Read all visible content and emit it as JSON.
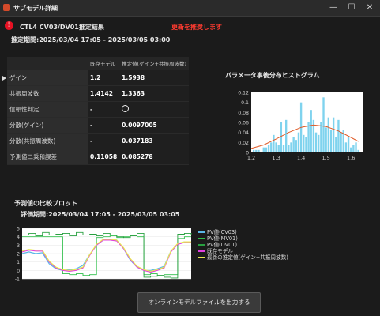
{
  "window": {
    "title": "サブモデル詳細",
    "minimize_glyph": "—",
    "maximize_glyph": "☐",
    "close_glyph": "✕"
  },
  "header": {
    "alert_glyph": "!",
    "title": "CTL4  CV03/DV01推定結果",
    "recommend": "更新を推奨します",
    "period": "推定期間:2025/03/04 17:05 - 2025/03/05 03:00"
  },
  "table": {
    "col_current": "既存モデル",
    "col_estimate": "推定値(ゲイン+共振周波数)",
    "rows": [
      {
        "label": "ゲイン",
        "current": "1.2",
        "estimate": "1.5938"
      },
      {
        "label": "共振周波数",
        "current": "1.4142",
        "estimate": "1.3363"
      },
      {
        "label": "信頼性判定",
        "current": "-",
        "estimate": ""
      },
      {
        "label": "分散(ゲイン)",
        "current": "-",
        "estimate": "0.0097005"
      },
      {
        "label": "分散(共振周波数)",
        "current": "-",
        "estimate": "0.037183"
      },
      {
        "label": "予測値二乗和誤差",
        "current": "0.11058",
        "estimate": "0.085278"
      }
    ]
  },
  "histogram": {
    "title": "パラメータ事後分布ヒストグラム",
    "bar_color": "#7fd3ee",
    "curve_color": "#e05a26"
  },
  "comparison": {
    "title": "予測値の比較プロット",
    "period": "評価期間:2025/03/04 17:05 - 2025/03/05 03:05"
  },
  "legend": [
    {
      "label": "PV値(CV03)",
      "color": "#5bb8e8"
    },
    {
      "label": "PV値(MV01)",
      "color": "#2fbf4a"
    },
    {
      "label": "PV値(DV01)",
      "color": "#28a040"
    },
    {
      "label": "既存モデル",
      "color": "#e040e0"
    },
    {
      "label": "最新の推定値(ゲイン+共振周波数)",
      "color": "#e8e850"
    }
  ],
  "export_button": "オンラインモデルファイルを出力する",
  "chart_data": [
    {
      "type": "bar",
      "title": "パラメータ事後分布ヒストグラム",
      "xlim": [
        1.2,
        1.65
      ],
      "ylim": [
        0,
        0.12
      ],
      "x_ticks": [
        "1.2",
        "1.3",
        "1.4",
        "1.5",
        "1.6"
      ],
      "y_ticks": [
        "0",
        "0.02",
        "0.04",
        "0.06",
        "0.08",
        "0.1",
        "0.12"
      ],
      "x": [
        1.21,
        1.22,
        1.23,
        1.25,
        1.26,
        1.27,
        1.28,
        1.29,
        1.3,
        1.31,
        1.32,
        1.33,
        1.34,
        1.35,
        1.36,
        1.37,
        1.38,
        1.39,
        1.4,
        1.41,
        1.42,
        1.43,
        1.44,
        1.45,
        1.46,
        1.47,
        1.48,
        1.49,
        1.5,
        1.51,
        1.52,
        1.53,
        1.54,
        1.55,
        1.56,
        1.57,
        1.58,
        1.59,
        1.6,
        1.61,
        1.62,
        1.63
      ],
      "values": [
        0.005,
        0.005,
        0.005,
        0.01,
        0.01,
        0.015,
        0.02,
        0.035,
        0.02,
        0.015,
        0.06,
        0.015,
        0.065,
        0.015,
        0.02,
        0.03,
        0.025,
        0.04,
        0.1,
        0.035,
        0.03,
        0.06,
        0.085,
        0.065,
        0.04,
        0.035,
        0.06,
        0.11,
        0.05,
        0.07,
        0.045,
        0.07,
        0.03,
        0.065,
        0.04,
        0.045,
        0.02,
        0.03,
        0.01,
        0.015,
        0.02,
        0.005
      ],
      "curve": {
        "x": [
          1.2,
          1.25,
          1.3,
          1.35,
          1.4,
          1.45,
          1.5,
          1.55,
          1.6,
          1.63
        ],
        "y": [
          0.008,
          0.015,
          0.027,
          0.04,
          0.05,
          0.055,
          0.052,
          0.043,
          0.03,
          0.022
        ]
      }
    },
    {
      "type": "line",
      "title": "予測値の比較プロット",
      "ylim": [
        -1,
        5
      ],
      "y_ticks": [
        "-1",
        "0",
        "1",
        "2",
        "3",
        "4",
        "5"
      ],
      "x": [
        0,
        4,
        8,
        12,
        16,
        20,
        24,
        28,
        32,
        36,
        40,
        44,
        48,
        52,
        56,
        60,
        64,
        68,
        72,
        76,
        80,
        84,
        88,
        92,
        96,
        100
      ],
      "series": [
        {
          "name": "PV値(CV03)",
          "values": [
            2.0,
            2.2,
            2.0,
            2.1,
            0.8,
            0.2,
            0.0,
            0.1,
            0.2,
            0.6,
            1.9,
            3.0,
            3.6,
            3.7,
            3.6,
            2.6,
            1.2,
            0.4,
            0.0,
            0.0,
            0.2,
            0.5,
            2.3,
            3.1,
            3.4,
            3.3
          ]
        },
        {
          "name": "PV値(MV01)",
          "values": [
            4.0,
            4.0,
            4.0,
            4.0,
            4.0,
            4.0,
            -0.4,
            -0.5,
            -0.4,
            -0.6,
            -0.5,
            3.9,
            4.0,
            4.1,
            3.9,
            4.0,
            4.1,
            4.0,
            -0.5,
            -0.4,
            -0.6,
            -0.5,
            -0.5,
            3.8,
            4.0,
            4.0
          ]
        },
        {
          "name": "PV値(DV01)",
          "values": [
            4.2,
            4.4,
            4.1,
            4.5,
            4.2,
            4.3,
            4.4,
            4.1,
            4.5,
            4.2,
            4.3,
            4.1,
            4.4,
            4.2,
            4.0,
            3.9,
            4.1,
            4.4,
            -0.8,
            -0.7,
            -0.6,
            -0.8,
            -0.9,
            4.3,
            4.4,
            4.2
          ]
        },
        {
          "name": "既存モデル",
          "values": [
            2.2,
            2.4,
            2.3,
            2.3,
            1.0,
            0.3,
            0.0,
            -0.1,
            0.0,
            0.3,
            1.8,
            3.0,
            3.6,
            3.6,
            3.5,
            2.6,
            1.3,
            0.4,
            0.0,
            -0.2,
            0.0,
            0.3,
            2.2,
            3.1,
            3.3,
            3.3
          ]
        },
        {
          "name": "最新の推定値(ゲイン+共振周波数)",
          "values": [
            2.3,
            2.5,
            2.4,
            2.4,
            1.1,
            0.4,
            0.1,
            0.0,
            0.1,
            0.4,
            1.9,
            3.1,
            3.7,
            3.7,
            3.6,
            2.7,
            1.4,
            0.5,
            0.1,
            -0.1,
            0.1,
            0.4,
            2.3,
            3.2,
            3.4,
            3.4
          ]
        }
      ]
    }
  ]
}
